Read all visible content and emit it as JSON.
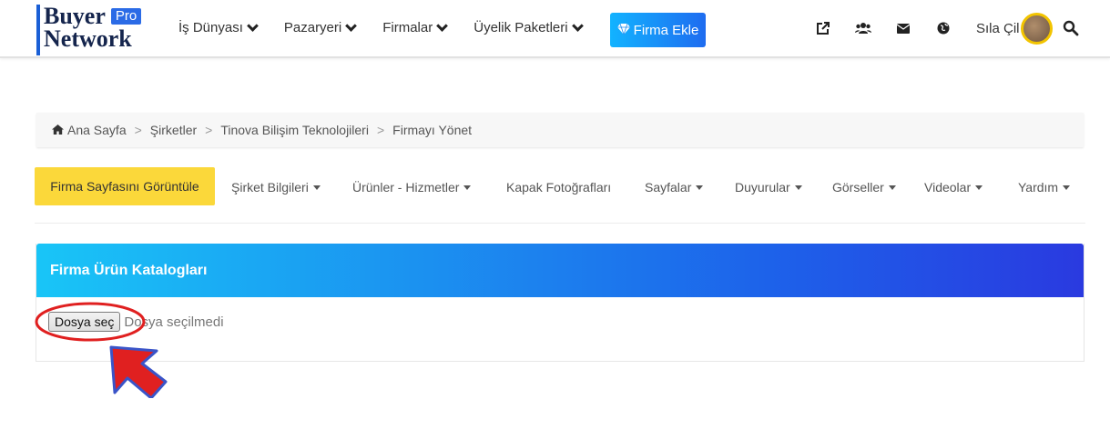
{
  "navbar": {
    "logo": {
      "word1": "Buyer",
      "badge": "Pro",
      "word2": "Network"
    },
    "menu": [
      {
        "label": "İş Dünyası"
      },
      {
        "label": "Pazaryeri"
      },
      {
        "label": "Firmalar"
      },
      {
        "label": "Üyelik Paketleri"
      }
    ],
    "cta_label": "Firma Ekle",
    "icons": [
      "external-link-icon",
      "users-icon",
      "envelope-icon",
      "globe-icon"
    ],
    "user_name": "Sıla Çil",
    "search_icon": "search-icon"
  },
  "breadcrumb": {
    "items": [
      "Ana Sayfa",
      "Şirketler",
      "Tinova Bilişim Teknolojileri",
      "Firmayı Yönet"
    ],
    "separator": ">"
  },
  "subnav": {
    "active_label": "Firma Sayfasını Görüntüle",
    "items": [
      {
        "label": "Şirket Bilgileri",
        "dropdown": true
      },
      {
        "label": "Ürünler - Hizmetler",
        "dropdown": true
      },
      {
        "label": "Kapak Fotoğrafları",
        "dropdown": false
      },
      {
        "label": "Sayfalar",
        "dropdown": true
      },
      {
        "label": "Duyurular",
        "dropdown": true
      },
      {
        "label": "Görseller",
        "dropdown": true
      },
      {
        "label": "Videolar",
        "dropdown": true
      },
      {
        "label": "Yardım",
        "dropdown": true
      }
    ]
  },
  "panel": {
    "title": "Firma Ürün Katalogları",
    "file_button_label": "Dosya seç",
    "file_status": "Dosya seçilmedi"
  },
  "colors": {
    "active_tab": "#fbd83a",
    "panel_gradient_start": "#19c5f7",
    "panel_gradient_end": "#2a3ae0",
    "annotation": "#e02020"
  }
}
